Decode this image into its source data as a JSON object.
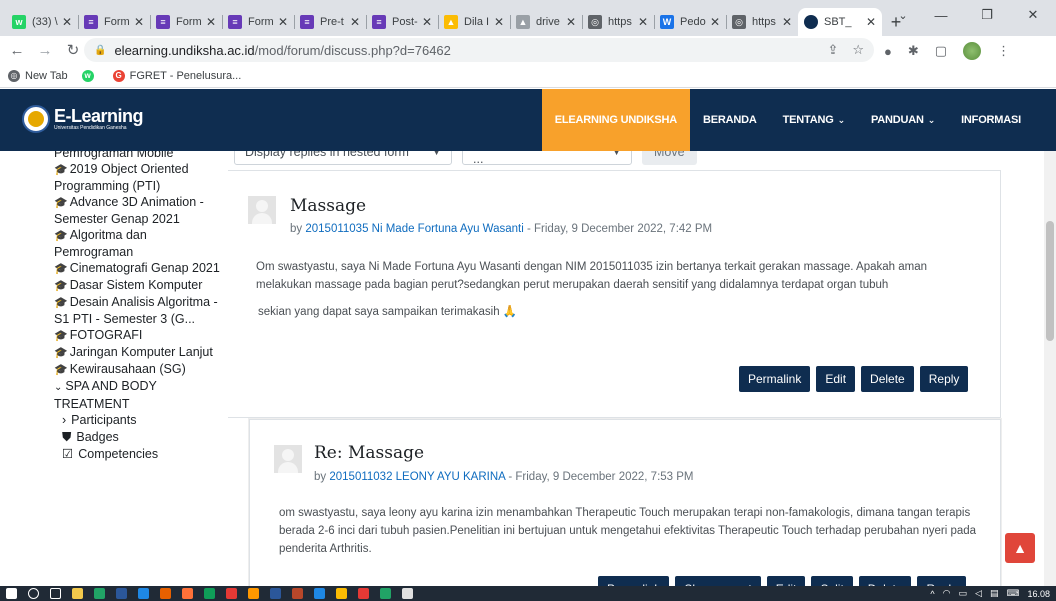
{
  "browser": {
    "tabs": [
      {
        "title": "(33) \\",
        "favicon_color": "#25d366",
        "favicon_glyph": "w"
      },
      {
        "title": "Form",
        "favicon_color": "#673ab7",
        "favicon_glyph": "≡"
      },
      {
        "title": "Form",
        "favicon_color": "#673ab7",
        "favicon_glyph": "≡"
      },
      {
        "title": "Form",
        "favicon_color": "#673ab7",
        "favicon_glyph": "≡"
      },
      {
        "title": "Pre-t",
        "favicon_color": "#673ab7",
        "favicon_glyph": "≡"
      },
      {
        "title": "Post-",
        "favicon_color": "#673ab7",
        "favicon_glyph": "≡"
      },
      {
        "title": "Dila I",
        "favicon_color": "#fbbc04",
        "favicon_glyph": "▲"
      },
      {
        "title": "drive",
        "favicon_color": "#9aa0a6",
        "favicon_glyph": "▲"
      },
      {
        "title": "https",
        "favicon_color": "#5f6368",
        "favicon_glyph": "◎"
      },
      {
        "title": "Pedo",
        "favicon_color": "#1a73e8",
        "favicon_glyph": "W"
      },
      {
        "title": "https",
        "favicon_color": "#5f6368",
        "favicon_glyph": "◎"
      }
    ],
    "active_tab": {
      "title": "SBT_",
      "favicon_color": "#0f2d50"
    },
    "new_tab_label": "+",
    "url_host": "elearning.undiksha.ac.id",
    "url_path": "/mod/forum/discuss.php?d=76462",
    "bookmarks": [
      {
        "label": "New Tab",
        "color": "#5f6368",
        "glyph": "◎"
      },
      {
        "label": "",
        "color": "#25d366",
        "glyph": "w"
      },
      {
        "label": "FGRET - Penelusura...",
        "color": "#ea4335",
        "glyph": "G"
      }
    ]
  },
  "site": {
    "logo_title": "E-Learning",
    "logo_subtitle": "Universitas Pendidikan Ganesha",
    "menu": [
      {
        "label": "ELEARNING UNDIKSHA",
        "highlight": true,
        "dropdown": false
      },
      {
        "label": "BERANDA",
        "highlight": false,
        "dropdown": false
      },
      {
        "label": "TENTANG",
        "highlight": false,
        "dropdown": true
      },
      {
        "label": "PANDUAN",
        "highlight": false,
        "dropdown": true
      },
      {
        "label": "INFORMASI",
        "highlight": false,
        "dropdown": false
      }
    ]
  },
  "sidebar": {
    "courses": [
      "Pemrograman Mobile",
      "2019 Object Oriented Programming (PTI)",
      "Advance 3D Animation - Semester Genap 2021",
      "Algoritma dan Pemrograman",
      "Cinematografi Genap 2021",
      "Dasar Sistem Komputer",
      "Desain Analisis Algoritma - S1 PTI - Semester 3 (G...",
      "FOTOGRAFI",
      "Jaringan Komputer Lanjut",
      "Kewirausahaan (SG)"
    ],
    "current_course": "SPA AND BODY TREATMENT",
    "sub_items": [
      {
        "label": "Participants",
        "icon": "›"
      },
      {
        "label": "Badges",
        "icon": "⛊"
      },
      {
        "label": "Competencies",
        "icon": "☑"
      }
    ]
  },
  "discussion": {
    "display_mode": "Display replies in nested form",
    "move_select": "Move this discussion to ...",
    "move_button": "Move",
    "posts": [
      {
        "title": "Massage",
        "by_prefix": "by",
        "author": "2015011035 Ni Made Fortuna Ayu Wasanti",
        "date": " - Friday, 9 December 2022, 7:42 PM",
        "message": "Om swastyastu, saya Ni Made Fortuna Ayu Wasanti dengan NIM 2015011035 izin bertanya terkait gerakan massage. Apakah aman melakukan massage pada bagian perut?sedangkan perut merupakan daerah sensitif yang didalamnya terdapat organ tubuh",
        "message2": "sekian yang dapat saya sampaikan terimakasih 🙏",
        "actions": [
          "Permalink",
          "Edit",
          "Delete",
          "Reply"
        ]
      },
      {
        "title": "Re: Massage",
        "by_prefix": "by",
        "author": "2015011032 LEONY AYU KARINA",
        "date": " - Friday, 9 December 2022, 7:53 PM",
        "message": "om swastyastu, saya leony ayu karina izin menambahkan Therapeutic Touch merupakan terapi non-famakologis, dimana tangan terapis berada 2-6 inci dari tubuh pasien.Penelitian ini bertujuan untuk mengetahui efektivitas Therapeutic Touch terhadap perubahan nyeri pada penderita Arthritis.",
        "actions": [
          "Permalink",
          "Show parent",
          "Edit",
          "Split",
          "Delete",
          "Reply"
        ]
      }
    ]
  },
  "taskbar": {
    "clock": "16.08",
    "icon_colors": [
      "#ffffff",
      "#ffffff",
      "#ffffff",
      "#f2c94c",
      "#21a366",
      "#2b579a",
      "#1e88e5",
      "#e66000",
      "#ff7139",
      "#0f9d58",
      "#e53935",
      "#ff9800",
      "#2b579a",
      "#b7472a",
      "#1e88e5",
      "#fbbc04",
      "#e53935",
      "#21a366",
      "#e0e0e0"
    ]
  },
  "colors": {
    "header_bg": "#0f2d50",
    "accent_orange": "#f8a12b",
    "button_bg": "#0f2d50",
    "link": "#0f6cbf",
    "back_to_top": "#e0463a"
  }
}
